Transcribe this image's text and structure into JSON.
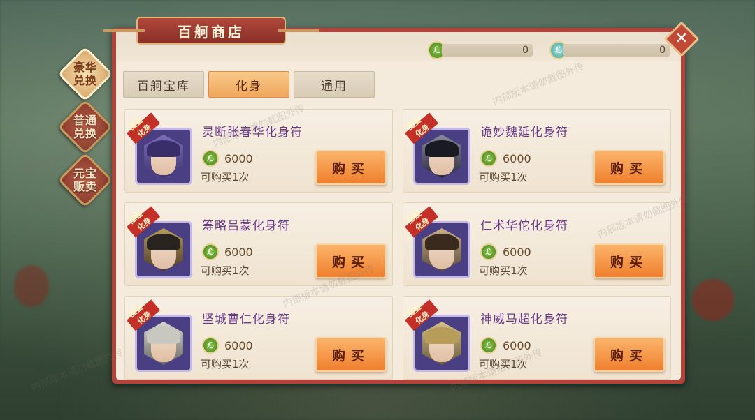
{
  "shop": {
    "title": "百舸商店"
  },
  "side_buttons": [
    {
      "label": "豪华兑换",
      "active": true
    },
    {
      "label": "普通兑换",
      "active": false
    },
    {
      "label": "元宝贩卖",
      "active": false
    }
  ],
  "currency": [
    {
      "icon": "green-coin-icon",
      "value": "0",
      "color": "#5a9a2c"
    },
    {
      "icon": "teal-coin-icon",
      "value": "0",
      "color": "#3a9e98"
    }
  ],
  "tabs": [
    {
      "label": "百舸宝库",
      "active": false
    },
    {
      "label": "化身",
      "active": true
    },
    {
      "label": "通用",
      "active": false
    }
  ],
  "item_badge": {
    "line1": "图鉴",
    "line2": "化身"
  },
  "items": [
    {
      "name": "灵断张春华化身符",
      "price": "6000",
      "limit": "可购买1次",
      "buy_label": "购买"
    },
    {
      "name": "诡妙魏延化身符",
      "price": "6000",
      "limit": "可购买1次",
      "buy_label": "购买"
    },
    {
      "name": "筹略吕蒙化身符",
      "price": "6000",
      "limit": "可购买1次",
      "buy_label": "购买"
    },
    {
      "name": "仁术华佗化身符",
      "price": "6000",
      "limit": "可购买1次",
      "buy_label": "购买"
    },
    {
      "name": "坚城曹仁化身符",
      "price": "6000",
      "limit": "可购买1次",
      "buy_label": "购买"
    },
    {
      "name": "神威马超化身符",
      "price": "6000",
      "limit": "可购买1次",
      "buy_label": "购买"
    }
  ],
  "watermark": "内部版本请勿截图外传",
  "colors": {
    "panel_border": "#b3433a",
    "active_tab": "#f0a65c",
    "buy_button": "#ef7f2e",
    "item_name": "#6a3a8a"
  }
}
